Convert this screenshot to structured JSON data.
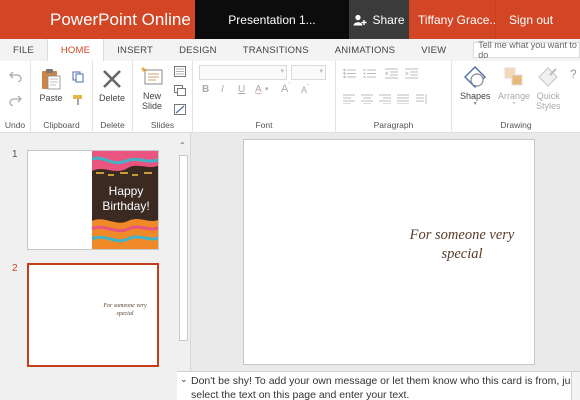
{
  "app": {
    "brand": "PowerPoint Online",
    "doc_title": "Presentation 1...",
    "share_label": "Share",
    "user": "Tiffany Grace...",
    "signout": "Sign out"
  },
  "tabs": [
    "FILE",
    "HOME",
    "INSERT",
    "DESIGN",
    "TRANSITIONS",
    "ANIMATIONS",
    "VIEW"
  ],
  "active_tab": "HOME",
  "tellme_placeholder": "Tell me what you want to do",
  "ribbon": {
    "groups": {
      "undo": "Undo",
      "clipboard": "Clipboard",
      "delete": "Delete",
      "slides": "Slides",
      "font": "Font",
      "paragraph": "Paragraph",
      "drawing": "Drawing"
    },
    "buttons": {
      "paste": "Paste",
      "delete": "Delete",
      "new_slide_1": "New",
      "new_slide_2": "Slide",
      "shapes": "Shapes",
      "arrange": "Arrange",
      "quick_styles_1": "Quick",
      "quick_styles_2": "Styles"
    }
  },
  "slides": [
    {
      "number": "1",
      "title_line1": "Happy",
      "title_line2": "Birthday!"
    },
    {
      "number": "2",
      "text_line1": "For someone very",
      "text_line2": "special"
    }
  ],
  "slide_text": {
    "line1": "For someone very",
    "line2": "special"
  },
  "notes": "Don't be shy! To add your own message or let them know who this card is from, just select the text on this page and enter your text.",
  "colors": {
    "brand": "#d24625",
    "selection": "#c43e1c",
    "dark_title": "#0c0c0c"
  }
}
